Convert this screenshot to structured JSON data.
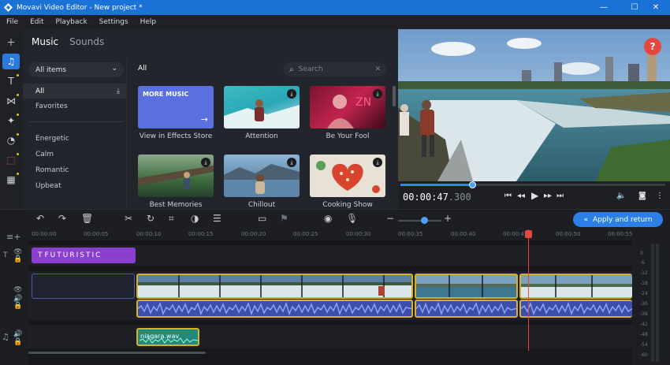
{
  "window": {
    "title": "Movavi Video Editor - New project *",
    "controls": [
      "minimize-icon",
      "maximize-icon",
      "close-icon"
    ]
  },
  "menu": [
    "File",
    "Edit",
    "Playback",
    "Settings",
    "Help"
  ],
  "left_toolbar": [
    "add-icon",
    "music-icon",
    "titles-icon",
    "transitions-icon",
    "effects-icon",
    "stickers-icon",
    "filters-icon",
    "more-tools-icon"
  ],
  "panel": {
    "tabs": [
      "Music",
      "Sounds"
    ],
    "filter_value": "All items",
    "categories": {
      "all": "All",
      "favorites": "Favorites",
      "energetic": "Energetic",
      "calm": "Calm",
      "romantic": "Romantic",
      "upbeat": "Upbeat"
    },
    "grid_label": "All",
    "search_placeholder": "Search",
    "tracks": [
      {
        "label": "View in Effects Store",
        "thumb": "MORE MUSIC"
      },
      {
        "label": "Attention"
      },
      {
        "label": "Be Your Fool"
      },
      {
        "label": "Best Memories"
      },
      {
        "label": "Chillout"
      },
      {
        "label": "Cooking Show"
      }
    ]
  },
  "preview": {
    "help_label": "?",
    "time_main": "00:00:47",
    "time_frac": ".300",
    "progress": 0.27
  },
  "timeline_toolbar": {
    "apply_label": "Apply and return",
    "zoom_level": 0.55
  },
  "ruler": [
    "00:00:00",
    "00:00:05",
    "00:00:10",
    "00:00:15",
    "00:00:20",
    "00:00:25",
    "00:00:30",
    "00:00:35",
    "00:00:40",
    "00:00:45",
    "00:00:50",
    "00:00:55"
  ],
  "tracks": {
    "title_clip": "FUTURISTIC",
    "music_clip": "niagara.wav"
  },
  "vu_labels": [
    "0",
    "-6",
    "-12",
    "-18",
    "-24",
    "-30",
    "-36",
    "-42",
    "-48",
    "-54",
    "-60"
  ],
  "colors": {
    "accent": "#2c7fe6",
    "title_clip": "#8a3fcf",
    "audio_clip": "#3c4fa8",
    "music_clip": "#1f8a7e",
    "playhead": "#e5473e",
    "clip_border": "#d7b02c"
  }
}
